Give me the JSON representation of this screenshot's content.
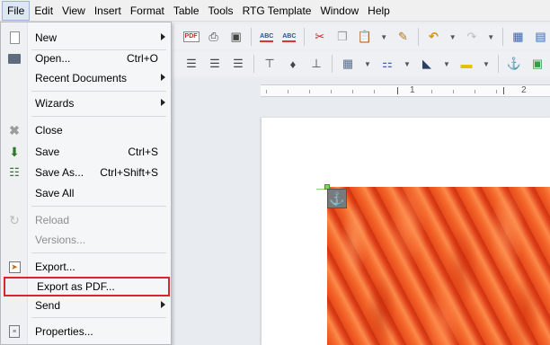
{
  "menubar": {
    "items": [
      "File",
      "Edit",
      "View",
      "Insert",
      "Format",
      "Table",
      "Tools",
      "RTG Template",
      "Window",
      "Help"
    ],
    "active_index": 0
  },
  "file_menu": {
    "items": [
      {
        "label": "New",
        "shortcut": "",
        "submenu": true,
        "icon": "new-document-icon",
        "enabled": true
      },
      {
        "label": "Open...",
        "shortcut": "Ctrl+O",
        "submenu": false,
        "icon": "open-folder-icon",
        "enabled": true
      },
      {
        "label": "Recent Documents",
        "shortcut": "",
        "submenu": true,
        "icon": "",
        "enabled": true
      },
      {
        "label": "Wizards",
        "shortcut": "",
        "submenu": true,
        "icon": "",
        "enabled": true
      },
      {
        "label": "Close",
        "shortcut": "",
        "submenu": false,
        "icon": "close-icon",
        "enabled": true
      },
      {
        "label": "Save",
        "shortcut": "Ctrl+S",
        "submenu": false,
        "icon": "save-icon",
        "enabled": true
      },
      {
        "label": "Save As...",
        "shortcut": "Ctrl+Shift+S",
        "submenu": false,
        "icon": "save-as-icon",
        "enabled": true
      },
      {
        "label": "Save All",
        "shortcut": "",
        "submenu": false,
        "icon": "",
        "enabled": true
      },
      {
        "label": "Reload",
        "shortcut": "",
        "submenu": false,
        "icon": "reload-icon",
        "enabled": false
      },
      {
        "label": "Versions...",
        "shortcut": "",
        "submenu": false,
        "icon": "",
        "enabled": false
      },
      {
        "label": "Export...",
        "shortcut": "",
        "submenu": false,
        "icon": "export-icon",
        "enabled": true
      },
      {
        "label": "Export as PDF...",
        "shortcut": "",
        "submenu": false,
        "icon": "",
        "enabled": true,
        "highlighted": true
      },
      {
        "label": "Send",
        "shortcut": "",
        "submenu": true,
        "icon": "",
        "enabled": true
      },
      {
        "label": "Properties...",
        "shortcut": "",
        "submenu": false,
        "icon": "properties-icon",
        "enabled": true
      }
    ]
  },
  "ruler": {
    "labels": [
      "1",
      "2"
    ]
  },
  "toolbar": {
    "pdf_label": "PDF",
    "spell_label": "ABC"
  },
  "colors": {
    "highlight_border": "#d9262e",
    "menu_background": "#f5f6f7",
    "flower_orange": "#ec5320"
  }
}
